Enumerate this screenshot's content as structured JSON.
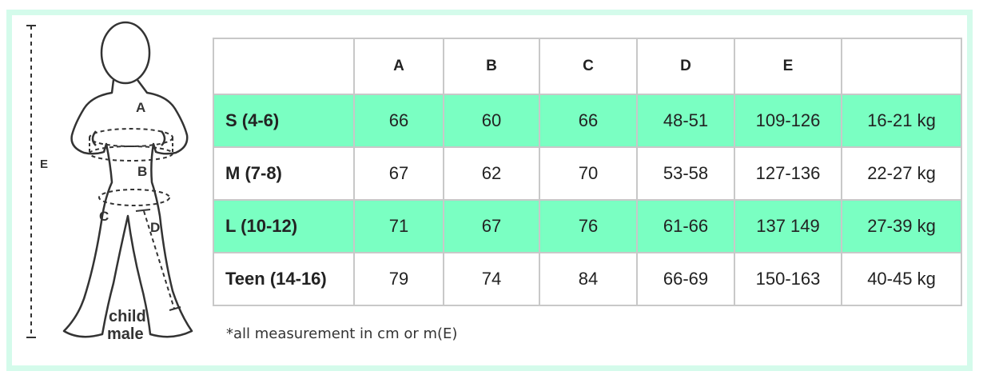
{
  "figure": {
    "labels": {
      "a": "A",
      "b": "B",
      "c": "C",
      "d": "D",
      "e": "E"
    },
    "caption_line1": "child",
    "caption_line2": "male"
  },
  "table": {
    "headers": [
      "",
      "A",
      "B",
      "C",
      "D",
      "E",
      ""
    ],
    "rows": [
      {
        "size": "S (4-6)",
        "a": "66",
        "b": "60",
        "c": "66",
        "d": "48-51",
        "e": "109-126",
        "weight": "16-21 kg"
      },
      {
        "size": "M (7-8)",
        "a": "67",
        "b": "62",
        "c": "70",
        "d": "53-58",
        "e": "127-136",
        "weight": "22-27 kg"
      },
      {
        "size": "L (10-12)",
        "a": "71",
        "b": "67",
        "c": "76",
        "d": "61-66",
        "e": "137 149",
        "weight": "27-39 kg"
      },
      {
        "size": "Teen (14-16)",
        "a": "79",
        "b": "74",
        "c": "84",
        "d": "66-69",
        "e": "150-163",
        "weight": "40-45 kg"
      }
    ]
  },
  "note": "*all measurement in cm or m(E)",
  "colors": {
    "frame": "#d4fbeb",
    "highlight_row": "#7affc2",
    "grid": "#c8c8c8"
  }
}
